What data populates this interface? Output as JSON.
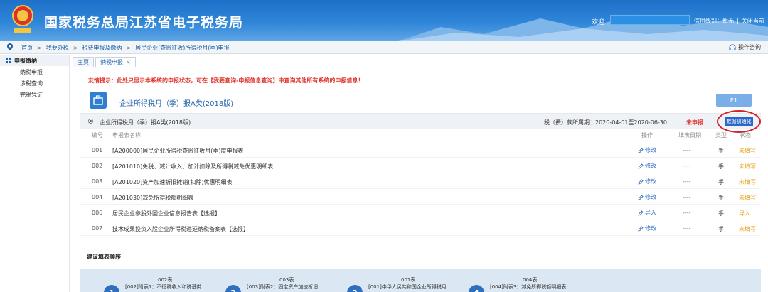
{
  "header": {
    "site_title": "国家税务总局江苏省电子税务局",
    "welcome": "欢迎",
    "credit": "信用级别：暂无",
    "close": "关闭当前"
  },
  "breadcrumb": {
    "items": [
      "首页",
      "我要办税",
      "税费申报及缴纳",
      "居民企业(查账征收)所得税月(季)申报"
    ],
    "help": "操作咨询"
  },
  "sidebar": {
    "title": "申报缴纳",
    "items": [
      "纳税申报",
      "涉税查询",
      "完税凭证"
    ]
  },
  "tabs": [
    {
      "label": "主页"
    },
    {
      "label": "纳税申报",
      "close": "×"
    }
  ],
  "notice": "友情提示：此处只显示本系统的申报状态，可在【我要查询-申报信息查询】中查询其他所有系统的申报信息！",
  "form": {
    "title": "企业所得税月（季）报A类(2018版)",
    "top_button": "E1"
  },
  "group": {
    "name": "企业所得税月（季）报A类(2018版)",
    "period": "税（费）款所属期：2020-04-01至2020-06-30",
    "status": "未申报",
    "init_button": "数据初始化"
  },
  "columns": {
    "no": "编号",
    "name": "申报表名称",
    "op": "操作",
    "date": "填表日期",
    "type": "类型",
    "state": "状态"
  },
  "rows": [
    {
      "no": "001",
      "name": "[A200000]居民企业所得税查账征收月(季)度申报表",
      "op": "修改",
      "date": "----",
      "type": "手",
      "state": "未填写"
    },
    {
      "no": "002",
      "name": "[A201010]免税、减计收入、加计扣除及所得税减免优惠明细表",
      "op": "修改",
      "date": "----",
      "type": "手",
      "state": "未填写"
    },
    {
      "no": "003",
      "name": "[A201020]资产加速折旧摊销(扣除)优惠明细表",
      "op": "修改",
      "date": "----",
      "type": "手",
      "state": "未填写"
    },
    {
      "no": "004",
      "name": "[A201030]减免所得税额明细表",
      "op": "修改",
      "date": "----",
      "type": "手",
      "state": "未填写"
    },
    {
      "no": "006",
      "name": "居民企业参股外国企业信息报告表【选报】",
      "op": "导入",
      "date": "----",
      "type": "手",
      "state": "导入"
    },
    {
      "no": "007",
      "name": "技术成果投资入股企业所得税递延纳税备案表【选报】",
      "op": "修改",
      "date": "----",
      "type": "手",
      "state": "未填写"
    }
  ],
  "suggest": {
    "title": "建议填表顺序",
    "steps": [
      {
        "num": "1",
        "code": "002表",
        "desc": "[002]附表1：不征税收入和税基类"
      },
      {
        "num": "2",
        "code": "003表",
        "desc": "[003]附表2：固定资产加速折旧"
      },
      {
        "num": "3",
        "code": "001表",
        "desc": "[001]中华人民共和国企业所得税月"
      },
      {
        "num": "4",
        "code": "004表",
        "desc": "[004]附表3：减免所得税额明细表"
      }
    ]
  },
  "colors": {
    "brand": "#1d70c8",
    "link": "#2f6fbd",
    "alert": "#e0332a",
    "pending": "#e8a21a"
  }
}
